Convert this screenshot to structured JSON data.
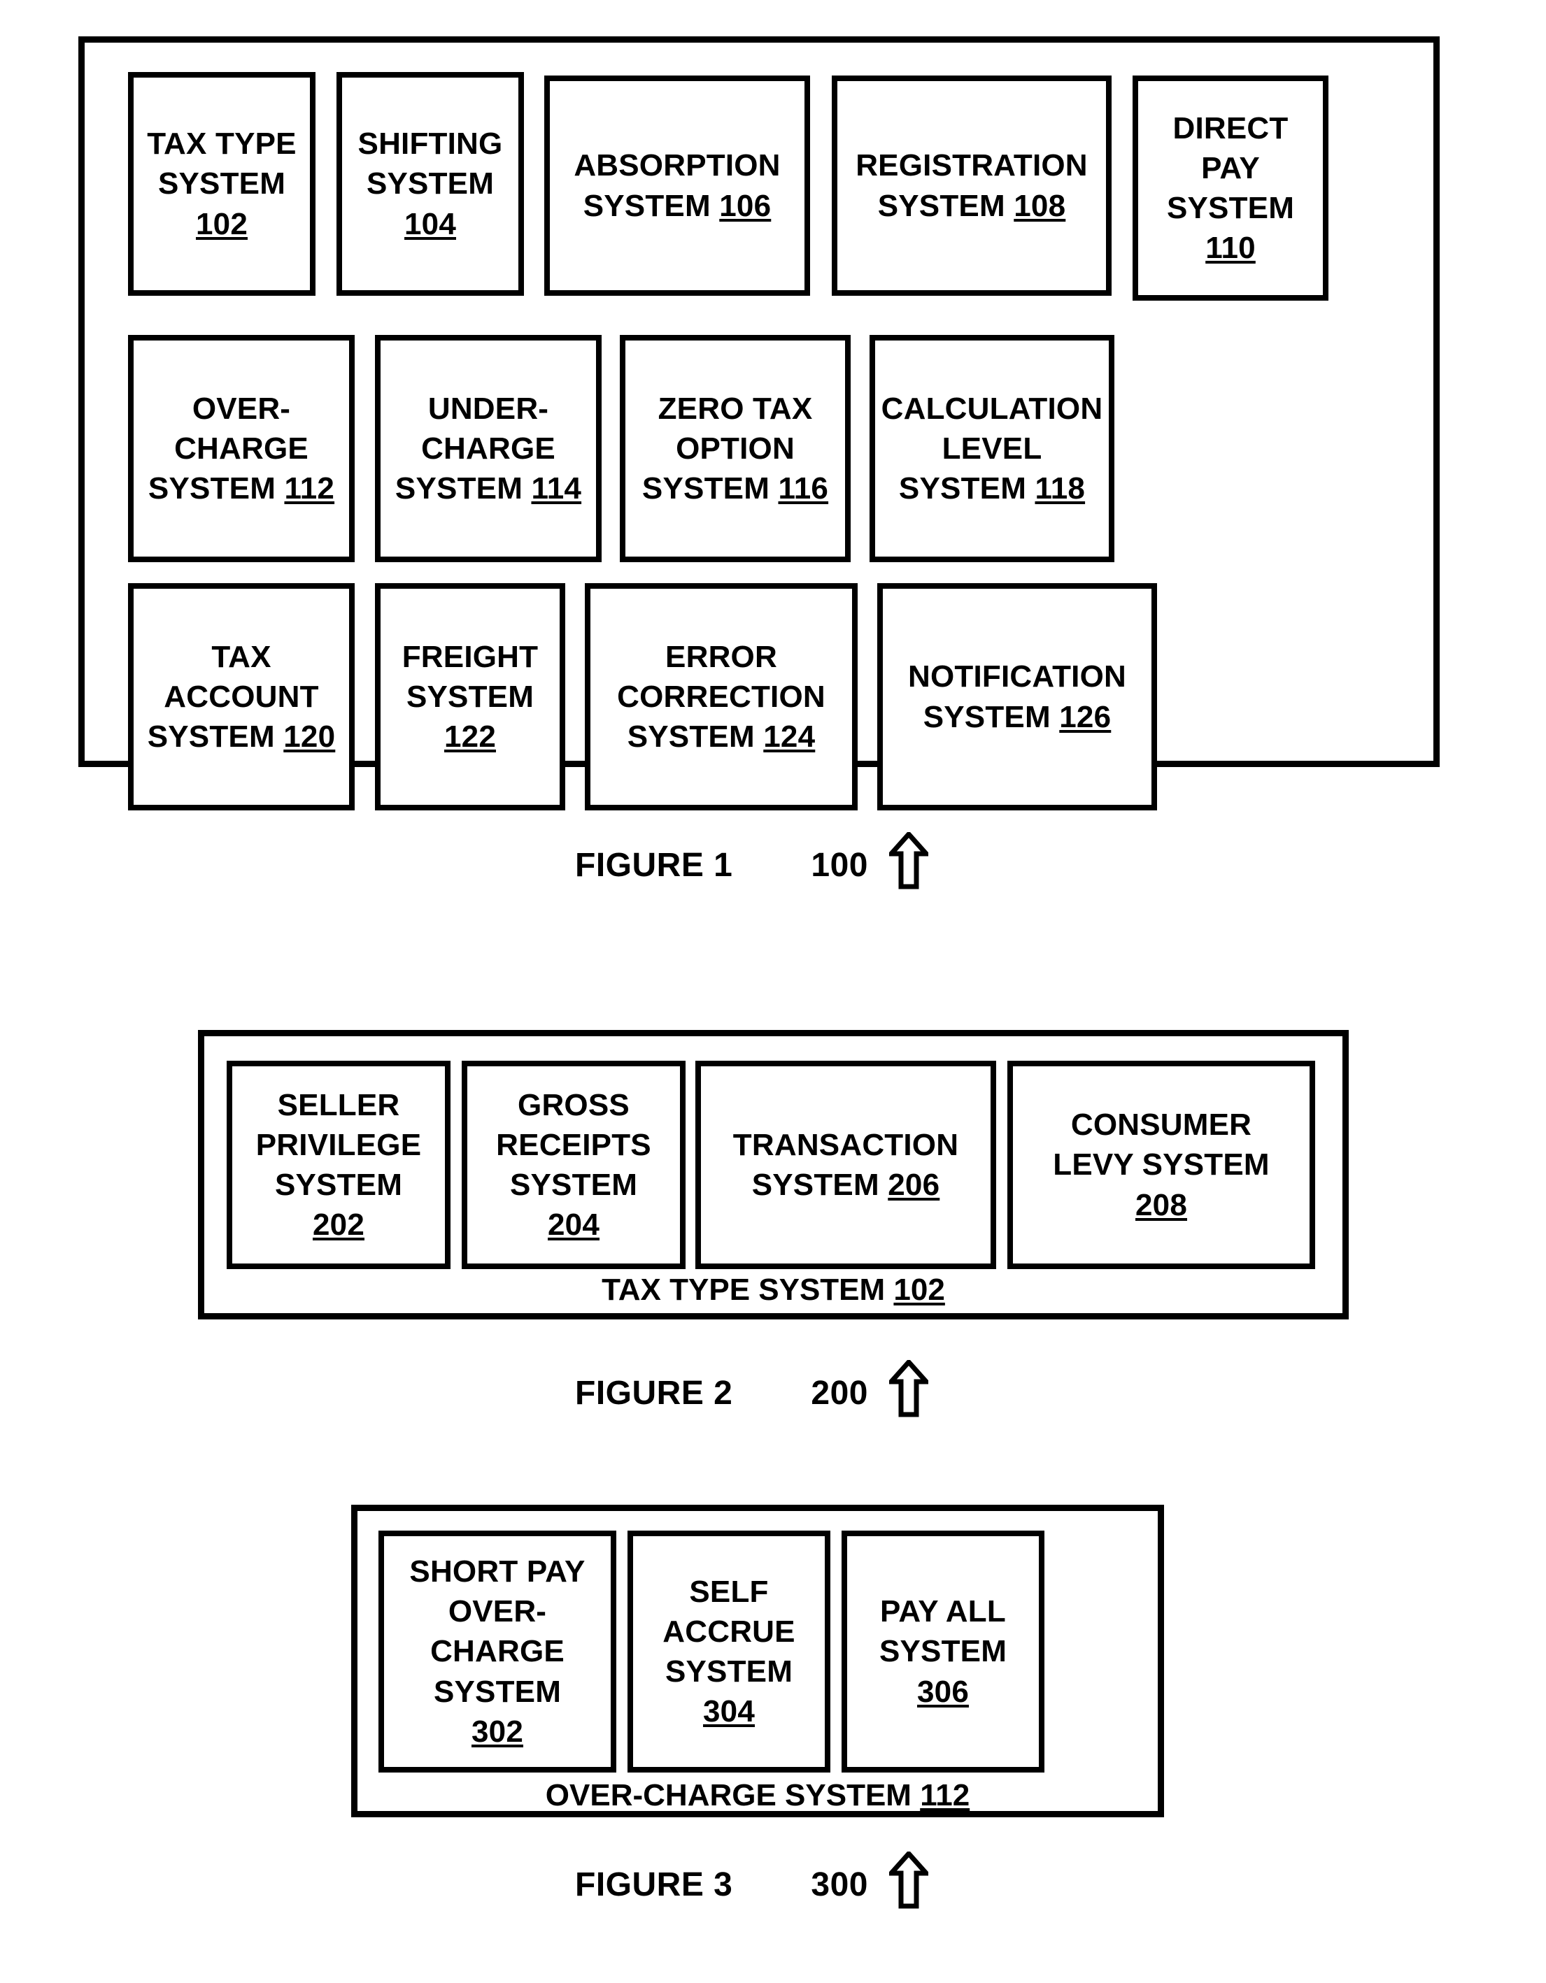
{
  "document": {
    "type": "patent-drawing-sheet",
    "figures": [
      "FIGURE 1",
      "FIGURE 2",
      "FIGURE 3"
    ]
  },
  "figure1": {
    "caption": "FIGURE 1",
    "reference_number": "100",
    "arrow_icon": "up-arrow-outline-icon",
    "boxes": [
      {
        "id": "102",
        "line1": "TAX TYPE",
        "line2": "SYSTEM",
        "line3": "102",
        "ref_on_line": 3
      },
      {
        "id": "104",
        "line1": "SHIFTING",
        "line2": "SYSTEM",
        "line3": "104",
        "ref_on_line": 3
      },
      {
        "id": "106",
        "line1": "ABSORPTION",
        "line2": "SYSTEM 106",
        "line3": "",
        "ref_on_line": 2
      },
      {
        "id": "108",
        "line1": "REGISTRATION",
        "line2": "SYSTEM 108",
        "line3": "",
        "ref_on_line": 2
      },
      {
        "id": "110",
        "line1": "DIRECT",
        "line2": "PAY",
        "line3": "SYSTEM",
        "line4": "110",
        "ref_on_line": 4
      },
      {
        "id": "112",
        "line1": "OVER-",
        "line2": "CHARGE",
        "line3": "SYSTEM 112",
        "ref_on_line": 3
      },
      {
        "id": "114",
        "line1": "UNDER-",
        "line2": "CHARGE",
        "line3": "SYSTEM 114",
        "ref_on_line": 3
      },
      {
        "id": "116",
        "line1": "ZERO TAX",
        "line2": "OPTION",
        "line3": "SYSTEM 116",
        "ref_on_line": 3
      },
      {
        "id": "118",
        "line1": "CALCULATION",
        "line2": "LEVEL",
        "line3": "SYSTEM 118",
        "ref_on_line": 3
      },
      {
        "id": "120",
        "line1": "TAX",
        "line2": "ACCOUNT",
        "line3": "SYSTEM 120",
        "ref_on_line": 3
      },
      {
        "id": "122",
        "line1": "FREIGHT",
        "line2": "SYSTEM",
        "line3": "122",
        "ref_on_line": 3
      },
      {
        "id": "124",
        "line1": "ERROR",
        "line2": "CORRECTION",
        "line3": "SYSTEM 124",
        "ref_on_line": 3
      },
      {
        "id": "126",
        "line1": "NOTIFICATION",
        "line2": "SYSTEM 126",
        "line3": "",
        "ref_on_line": 2
      }
    ],
    "box_text": {
      "b102_l1": "TAX TYPE",
      "b102_l2": "SYSTEM",
      "b102_ref": "102",
      "b104_l1": "SHIFTING",
      "b104_l2": "SYSTEM",
      "b104_ref": "104",
      "b106_l1": "ABSORPTION",
      "b106_l2": "SYSTEM",
      "b106_ref": "106",
      "b108_l1": "REGISTRATION",
      "b108_l2": "SYSTEM",
      "b108_ref": "108",
      "b110_l1": "DIRECT",
      "b110_l2": "PAY",
      "b110_l3": "SYSTEM",
      "b110_ref": "110",
      "b112_l1": "OVER-",
      "b112_l2": "CHARGE",
      "b112_l3": "SYSTEM",
      "b112_ref": "112",
      "b114_l1": "UNDER-",
      "b114_l2": "CHARGE",
      "b114_l3": "SYSTEM",
      "b114_ref": "114",
      "b116_l1": "ZERO TAX",
      "b116_l2": "OPTION",
      "b116_l3": "SYSTEM",
      "b116_ref": "116",
      "b118_l1": "CALCULATION",
      "b118_l2": "LEVEL",
      "b118_l3": "SYSTEM",
      "b118_ref": "118",
      "b120_l1": "TAX",
      "b120_l2": "ACCOUNT",
      "b120_l3": "SYSTEM",
      "b120_ref": "120",
      "b122_l1": "FREIGHT",
      "b122_l2": "SYSTEM",
      "b122_ref": "122",
      "b124_l1": "ERROR",
      "b124_l2": "CORRECTION",
      "b124_l3": "SYSTEM",
      "b124_ref": "124",
      "b126_l1": "NOTIFICATION",
      "b126_l2": "SYSTEM",
      "b126_ref": "126"
    }
  },
  "figure2": {
    "caption": "FIGURE 2",
    "reference_number": "200",
    "arrow_icon": "up-arrow-outline-icon",
    "container_label": "TAX TYPE SYSTEM",
    "container_ref": "102",
    "box_text": {
      "b202_l1": "SELLER",
      "b202_l2": "PRIVILEGE",
      "b202_l3": "SYSTEM",
      "b202_ref": "202",
      "b204_l1": "GROSS",
      "b204_l2": "RECEIPTS",
      "b204_l3": "SYSTEM",
      "b204_ref": "204",
      "b206_l1": "TRANSACTION",
      "b206_l2": "SYSTEM",
      "b206_ref": "206",
      "b208_l1": "CONSUMER",
      "b208_l2": "LEVY SYSTEM",
      "b208_ref": "208"
    }
  },
  "figure3": {
    "caption": "FIGURE 3",
    "reference_number": "300",
    "arrow_icon": "up-arrow-outline-icon",
    "container_label": "OVER-CHARGE SYSTEM",
    "container_ref": "112",
    "box_text": {
      "b302_l1": "SHORT PAY",
      "b302_l2": "OVER-",
      "b302_l3": "CHARGE",
      "b302_l4": "SYSTEM",
      "b302_ref": "302",
      "b304_l1": "SELF",
      "b304_l2": "ACCRUE",
      "b304_l3": "SYSTEM",
      "b304_ref": "304",
      "b306_l1": "PAY ALL",
      "b306_l2": "SYSTEM",
      "b306_ref": "306"
    }
  },
  "colors": {
    "ink": "#000000",
    "paper": "#ffffff"
  }
}
